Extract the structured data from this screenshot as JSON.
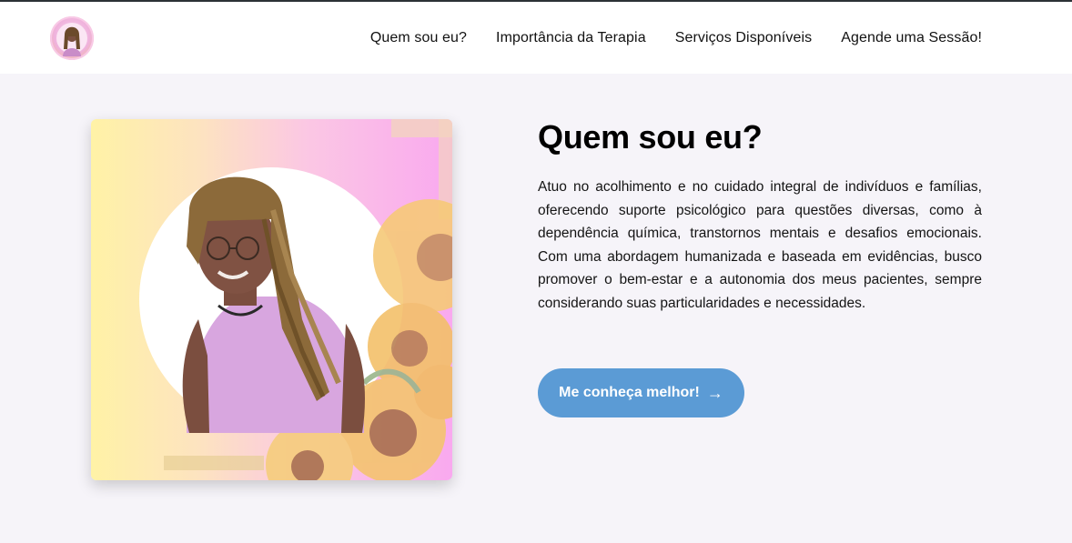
{
  "nav": {
    "links": [
      {
        "label": "Quem sou eu?"
      },
      {
        "label": "Importância da Terapia"
      },
      {
        "label": "Serviços Disponíveis"
      },
      {
        "label": "Agende uma Sessão!"
      }
    ]
  },
  "about": {
    "title": "Quem sou eu?",
    "paragraph": "Atuo no acolhimento e no cuidado integral de indivíduos e famílias, oferecendo suporte psicológico para questões diversas, como à dependência química, transtornos mentais e desafios emocionais. Com uma abordagem humanizada e baseada em evidências, busco promover o bem-estar e a autonomia dos meus pacientes, sempre considerando suas particularidades e necessidades.",
    "cta_label": "Me conheça melhor!",
    "cta_icon": "arrow-right-icon"
  },
  "colors": {
    "accent": "#5b9bd5",
    "background": "#f6f4f9",
    "navbar": "#ffffff"
  }
}
